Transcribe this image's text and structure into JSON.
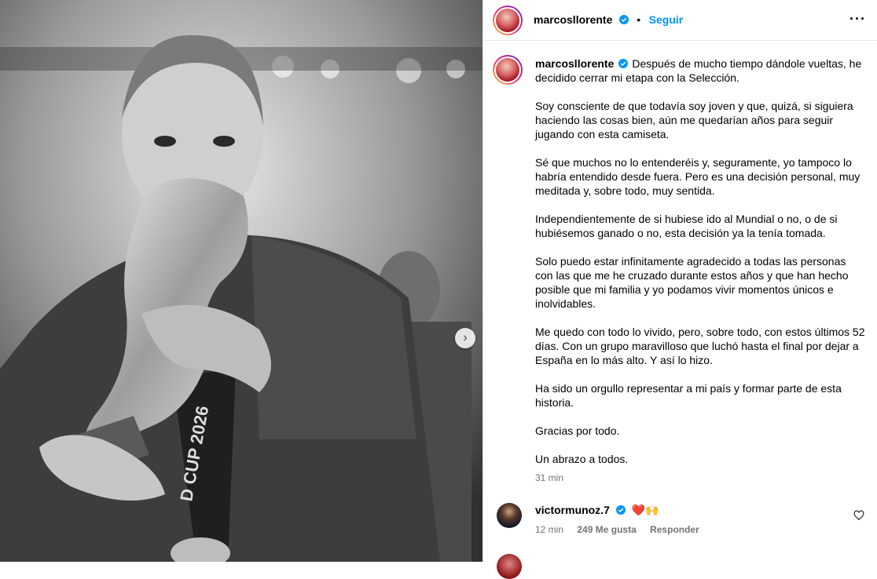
{
  "post": {
    "username": "marcosllorente",
    "follow_label": "Seguir",
    "separator": "•",
    "more_icon": "more-horizontal-icon",
    "verified_color": "#0095f6"
  },
  "caption": {
    "username": "marcosllorente",
    "first_line": "Después de mucho tiempo dándole vueltas, he decidido cerrar mi etapa con la Selección.",
    "paragraphs": [
      "Soy consciente de que todavía soy joven y que, quizá, si siguiera haciendo las cosas bien, aún me quedarían años para seguir jugando con esta camiseta.",
      "Sé que muchos no lo entenderéis y, seguramente, yo tampoco lo habría entendido desde fuera. Pero es una decisión personal, muy meditada y, sobre todo, muy sentida.",
      "Independientemente de si hubiese ido al Mundial o no, o de si hubiésemos ganado o no, esta decisión ya la tenía tomada.",
      "Solo puedo estar infinitamente agradecido a todas las personas con las que me he cruzado durante estos años y que han hecho posible que mi familia y yo podamos vivir momentos únicos e inolvidables.",
      "Me quedo con todo lo vivido, pero, sobre todo, con estos últimos 52 días. Con un grupo maravilloso que luchó hasta el final por dejar a España en lo más alto. Y así lo hizo.",
      "Ha sido un orgullo representar a mi país y formar parte de esta historia.",
      "Gracias por todo.",
      "Un abrazo a todos."
    ],
    "time": "31 min"
  },
  "comments": [
    {
      "username": "victormunoz.7",
      "text": "❤️🙌",
      "time": "12 min",
      "likes": "249 Me gusta",
      "reply_label": "Responder"
    }
  ],
  "photo": {
    "trophy_text": "D CUP 2026",
    "nav_icon": "chevron-right-icon"
  }
}
